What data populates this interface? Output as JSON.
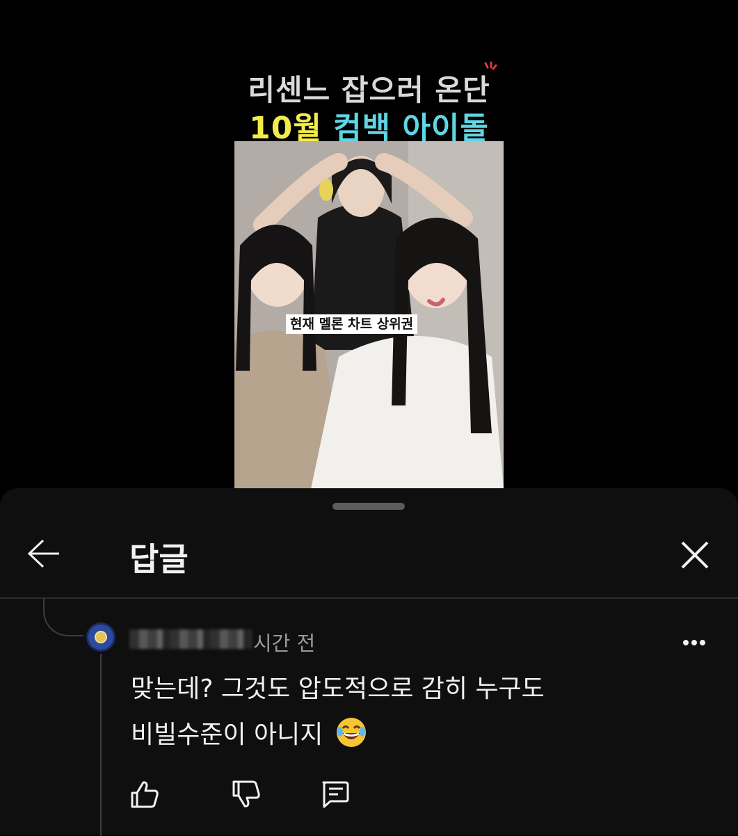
{
  "video": {
    "headline_line1": "리센느 잡으러 온단",
    "headline_line2_part1": "10월",
    "headline_line2_part2": "컴백",
    "headline_line2_part3": "아이돌",
    "caption": "현재 멜론 차트 상위권"
  },
  "sheet": {
    "title": "답글",
    "back_icon": "arrow-left-icon",
    "close_icon": "close-icon"
  },
  "comment": {
    "timestamp": "시간 전",
    "text_line1": "맞는데? 그것도 압도적으로 감히 누구도",
    "text_line2": "비빌수준이 아니지",
    "emoji": "face-with-tears-of-joy",
    "actions": [
      "thumbs-up-icon",
      "thumbs-down-icon",
      "reply-icon"
    ]
  },
  "colors": {
    "background": "#000000",
    "sheet": "#0f0f0f",
    "headline_yellow": "#f2ec4b",
    "headline_cyan": "#5fd6e4",
    "secondary_text": "#9a9a9a"
  }
}
